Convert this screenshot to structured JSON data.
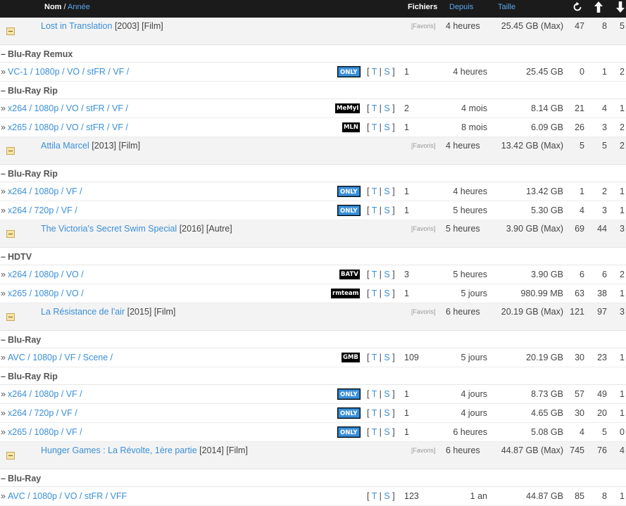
{
  "header": {
    "nom": "Nom",
    "sep": " / ",
    "annee": "Année",
    "fichiers": "Fichiers",
    "depuis": "Depuis",
    "taille": "Taille"
  },
  "rows": [
    {
      "kind": "film",
      "title": "Lost in Translation",
      "info": "[2003] [Film]",
      "fav": "[Favoris]",
      "depuis": "4 heures",
      "taille": "25.45 GB (Max)",
      "c1": "47",
      "c2": "8",
      "c3": "5"
    },
    {
      "kind": "cat",
      "label": "Blu-Ray Remux"
    },
    {
      "kind": "rel",
      "name": "VC-1 / 1080p / VO / stFR / VF /",
      "badge": "ONLY",
      "btype": "only",
      "files": "1",
      "depuis": "4 heures",
      "taille": "25.45 GB",
      "c1": "0",
      "c2": "1",
      "c3": "2"
    },
    {
      "kind": "cat",
      "label": "Blu-Ray Rip"
    },
    {
      "kind": "rel",
      "name": "x264 / 1080p / VO / stFR / VF /",
      "badge": "MeMyI",
      "btype": "black",
      "files": "2",
      "depuis": "4 mois",
      "taille": "8.14 GB",
      "c1": "21",
      "c2": "4",
      "c3": "1"
    },
    {
      "kind": "rel",
      "name": "x265 / 1080p / VO / stFR / VF /",
      "badge": "MLN",
      "btype": "black",
      "files": "1",
      "depuis": "8 mois",
      "taille": "6.09 GB",
      "c1": "26",
      "c2": "3",
      "c3": "2"
    },
    {
      "kind": "film",
      "title": "Attila Marcel",
      "info": "[2013] [Film]",
      "fav": "[Favoris]",
      "depuis": "4 heures",
      "taille": "13.42 GB (Max)",
      "c1": "5",
      "c2": "5",
      "c3": "2"
    },
    {
      "kind": "cat",
      "label": "Blu-Ray Rip"
    },
    {
      "kind": "rel",
      "name": "x264 / 1080p / VF /",
      "badge": "ONLY",
      "btype": "only",
      "files": "1",
      "depuis": "4 heures",
      "taille": "13.42 GB",
      "c1": "1",
      "c2": "2",
      "c3": "1"
    },
    {
      "kind": "rel",
      "name": "x264 / 720p / VF /",
      "badge": "ONLY",
      "btype": "only",
      "files": "1",
      "depuis": "5 heures",
      "taille": "5.30 GB",
      "c1": "4",
      "c2": "3",
      "c3": "1"
    },
    {
      "kind": "film",
      "title": "The Victoria's Secret Swim Special",
      "info": "[2016] [Autre]",
      "fav": "[Favoris]",
      "depuis": "5 heures",
      "taille": "3.90 GB (Max)",
      "c1": "69",
      "c2": "44",
      "c3": "3"
    },
    {
      "kind": "cat",
      "label": "HDTV"
    },
    {
      "kind": "rel",
      "name": "x264 / 1080p / VO /",
      "badge": "BATV",
      "btype": "black",
      "files": "3",
      "depuis": "5 heures",
      "taille": "3.90 GB",
      "c1": "6",
      "c2": "6",
      "c3": "2"
    },
    {
      "kind": "rel",
      "name": "x265 / 1080p / VO /",
      "badge": "rmteam",
      "btype": "black",
      "files": "1",
      "depuis": "5 jours",
      "taille": "980.99 MB",
      "c1": "63",
      "c2": "38",
      "c3": "1"
    },
    {
      "kind": "film",
      "title": "La Résistance de l'air",
      "info": "[2015] [Film]",
      "fav": "[Favoris]",
      "depuis": "6 heures",
      "taille": "20.19 GB (Max)",
      "c1": "121",
      "c2": "97",
      "c3": "3"
    },
    {
      "kind": "cat",
      "label": "Blu-Ray"
    },
    {
      "kind": "rel",
      "name": "AVC / 1080p / VF / Scene /",
      "badge": "GMB",
      "btype": "black",
      "files": "109",
      "depuis": "5 jours",
      "taille": "20.19 GB",
      "c1": "30",
      "c2": "23",
      "c3": "1"
    },
    {
      "kind": "cat",
      "label": "Blu-Ray Rip"
    },
    {
      "kind": "rel",
      "name": "x264 / 1080p / VF /",
      "badge": "ONLY",
      "btype": "only",
      "files": "1",
      "depuis": "4 jours",
      "taille": "8.73 GB",
      "c1": "57",
      "c2": "49",
      "c3": "1"
    },
    {
      "kind": "rel",
      "name": "x264 / 720p / VF /",
      "badge": "ONLY",
      "btype": "only",
      "files": "1",
      "depuis": "4 jours",
      "taille": "4.65 GB",
      "c1": "30",
      "c2": "20",
      "c3": "1"
    },
    {
      "kind": "rel",
      "name": "x265 / 1080p / VF /",
      "badge": "ONLY",
      "btype": "only",
      "files": "1",
      "depuis": "6 heures",
      "taille": "5.08 GB",
      "c1": "4",
      "c2": "5",
      "c3": "0"
    },
    {
      "kind": "film",
      "title": "Hunger Games : La Révolte, 1ère partie",
      "info": "[2014] [Film]",
      "fav": "[Favoris]",
      "depuis": "6 heures",
      "taille": "44.87 GB (Max)",
      "c1": "745",
      "c2": "76",
      "c3": "4"
    },
    {
      "kind": "cat",
      "label": "Blu-Ray"
    },
    {
      "kind": "rel",
      "name": "AVC / 1080p / VO / stFR / VFF",
      "badge": "",
      "btype": "",
      "files": "123",
      "depuis": "1 an",
      "taille": "44.87 GB",
      "c1": "85",
      "c2": "8",
      "c3": "1"
    }
  ],
  "links": {
    "open": "[",
    "t": "T",
    "sep": "|",
    "s": "S",
    "close": "]"
  },
  "markers": {
    "cat": "–",
    "rel": "»"
  }
}
